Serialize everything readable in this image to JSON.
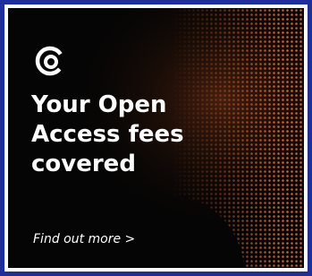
{
  "ad": {
    "headline_lines": [
      "Your Open",
      "Access fees",
      "covered"
    ],
    "cta_label": "Find out more >",
    "logo_icon": "c-swirl-logo-icon",
    "colors": {
      "border": "#1e2f9c",
      "background": "#050505",
      "text": "#ffffff",
      "dots": "#e26a2c"
    }
  }
}
